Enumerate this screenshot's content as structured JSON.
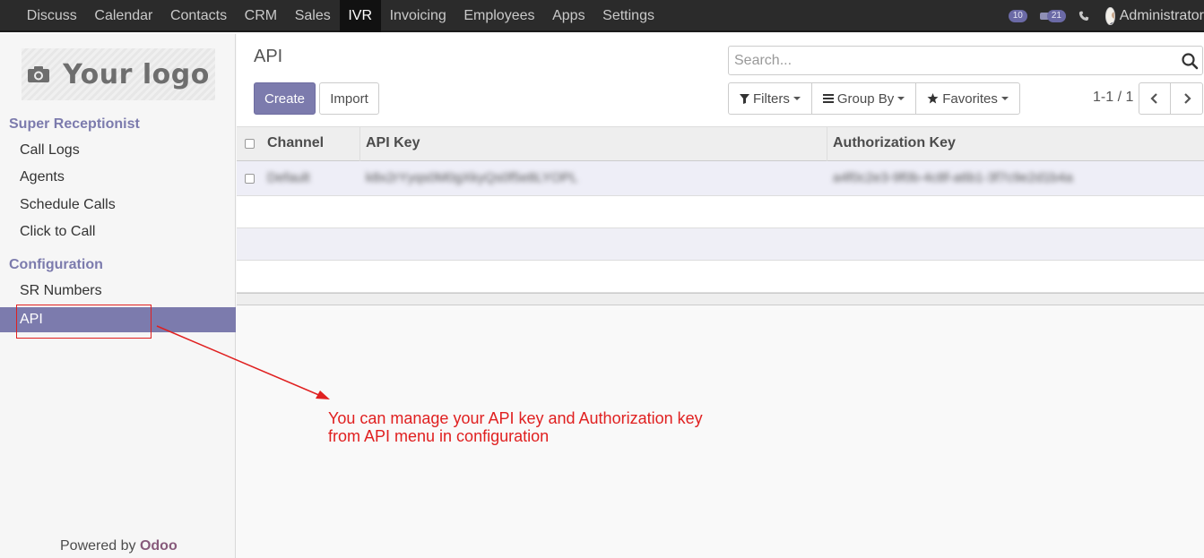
{
  "topnav": {
    "menu": [
      "Discuss",
      "Calendar",
      "Contacts",
      "CRM",
      "Sales",
      "IVR",
      "Invoicing",
      "Employees",
      "Apps",
      "Settings"
    ],
    "active_menu": "IVR",
    "activity_count": "10",
    "message_count": "21",
    "user_name": "Administrator"
  },
  "sidebar": {
    "logo_text": "Your logo",
    "sections": [
      {
        "title": "Super Receptionist",
        "items": [
          "Call Logs",
          "Agents",
          "Schedule Calls",
          "Click to Call"
        ]
      },
      {
        "title": "Configuration",
        "items": [
          "SR Numbers",
          "API"
        ]
      }
    ],
    "active_item": "API",
    "powered_prefix": "Powered by",
    "powered_brand": "Odoo"
  },
  "control": {
    "breadcrumb": "API",
    "create_label": "Create",
    "import_label": "Import",
    "search_placeholder": "Search...",
    "filters_label": "Filters",
    "group_by_label": "Group By",
    "favorites_label": "Favorites",
    "pager": "1-1 / 1"
  },
  "table": {
    "columns": [
      "Channel",
      "API Key",
      "Authorization Key"
    ],
    "rows": [
      {
        "channel": "Default",
        "api_key": "k8x2rYyqs0M0gXkyQs0f5e8LYOPL",
        "authorization_key": "a4f0c2e3-9f0b-4c8f-a6b1-3f7c9e2d1b4a"
      }
    ]
  },
  "annotation": {
    "line1": "You can manage your API key and Authorization key",
    "line2": "from API menu in configuration"
  },
  "colors": {
    "brand": "#7c7bad",
    "navbar": "#2b2b2b",
    "annotation": "#e02020"
  }
}
